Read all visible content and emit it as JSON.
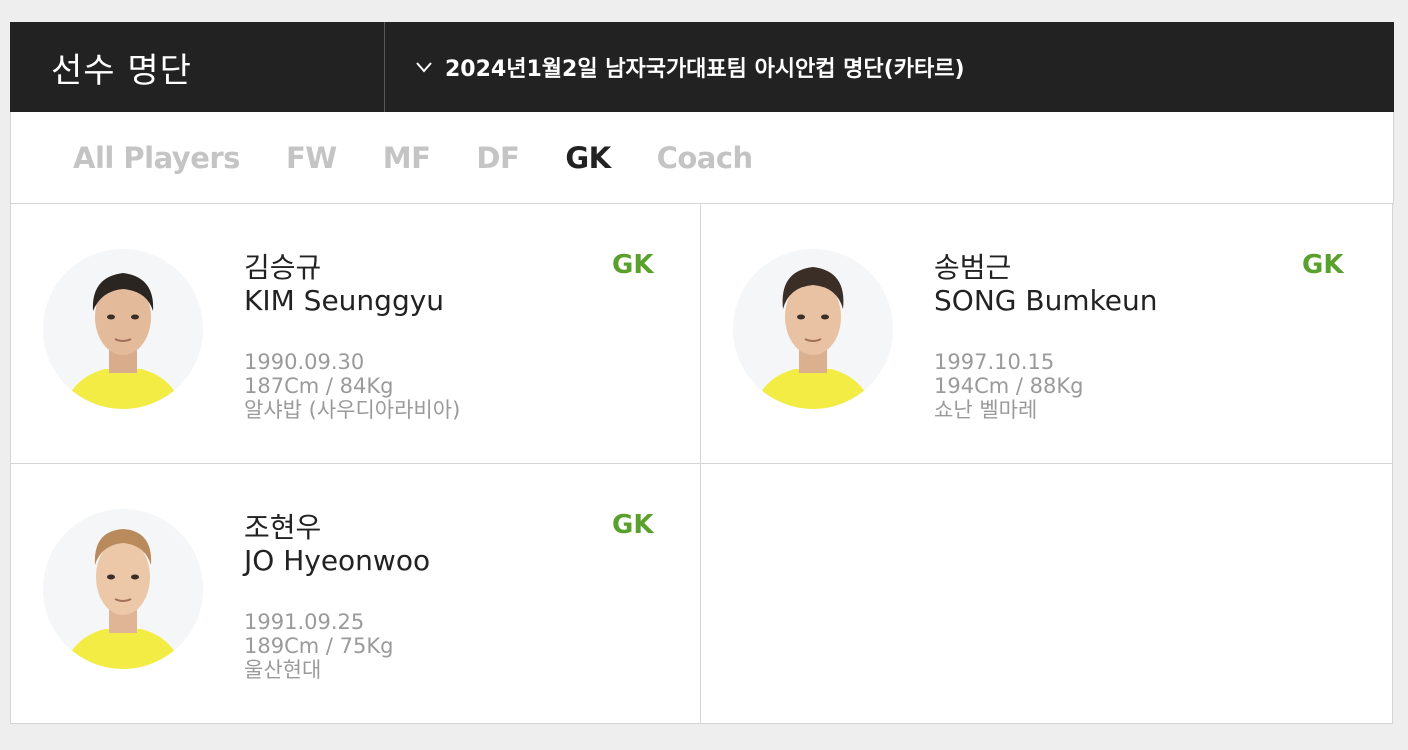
{
  "header": {
    "title": "선수 명단",
    "roster_select": "2024년1월2일 남자국가대표팀 아시안컵 명단(카타르)"
  },
  "tabs": [
    {
      "label": "All Players",
      "active": false
    },
    {
      "label": "FW",
      "active": false
    },
    {
      "label": "MF",
      "active": false
    },
    {
      "label": "DF",
      "active": false
    },
    {
      "label": "GK",
      "active": true
    },
    {
      "label": "Coach",
      "active": false
    }
  ],
  "players": [
    {
      "name_ko": "김승규",
      "name_en": "KIM Seunggyu",
      "position": "GK",
      "birth": "1990.09.30",
      "body": "187Cm / 84Kg",
      "club": "알샤밥 (사우디아라비아)"
    },
    {
      "name_ko": "송범근",
      "name_en": "SONG Bumkeun",
      "position": "GK",
      "birth": "1997.10.15",
      "body": "194Cm / 88Kg",
      "club": "쇼난 벨마레"
    },
    {
      "name_ko": "조현우",
      "name_en": "JO Hyeonwoo",
      "position": "GK",
      "birth": "1991.09.25",
      "body": "189Cm / 75Kg",
      "club": "울산현대"
    }
  ],
  "colors": {
    "header_bg": "#222222",
    "position_accent": "#5aa02c",
    "tab_inactive": "#c4c4c4",
    "tab_active": "#222222",
    "jersey": "#f3ec45"
  }
}
